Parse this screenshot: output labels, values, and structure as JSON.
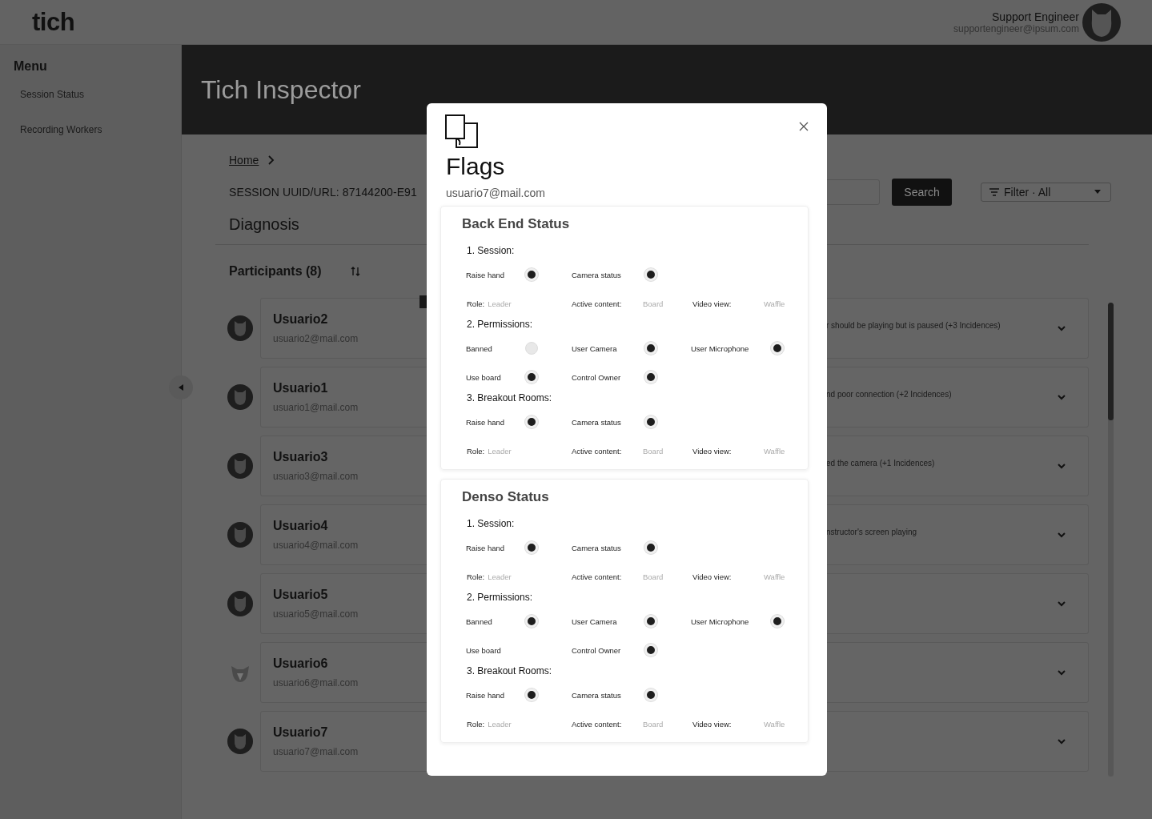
{
  "header": {
    "logo": "tich",
    "user": {
      "name": "Support Engineer",
      "email": "supportengineer@ipsum.com"
    }
  },
  "sidebar": {
    "title": "Menu",
    "items": [
      {
        "label": "Session Status"
      },
      {
        "label": "Recording Workers"
      }
    ]
  },
  "banner": {
    "title": "Tich Inspector"
  },
  "breadcrumb": [
    {
      "label": "Home"
    }
  ],
  "session": {
    "label": "SESSION UUID/URL: 87144200-E91"
  },
  "search": {
    "button": "Search"
  },
  "filter": {
    "label": "Filter · All"
  },
  "diagnosis": {
    "title": "Diagnosis"
  },
  "participants": {
    "title": "Participants (8)",
    "items": [
      {
        "name": "Usuario2",
        "email": "usuario2@mail.com",
        "issue": "r should be playing but is paused (+3 Incidences)",
        "kind": "icon"
      },
      {
        "name": "Usuario1",
        "email": "usuario1@mail.com",
        "issue": "nd poor connection (+2 Incidences)",
        "kind": "icon"
      },
      {
        "name": "Usuario3",
        "email": "usuario3@mail.com",
        "issue": "ed the camera  (+1 Incidences)",
        "kind": "icon"
      },
      {
        "name": "Usuario4",
        "email": "usuario4@mail.com",
        "issue": "nstructor's screen playing",
        "kind": "icon"
      },
      {
        "name": "Usuario5",
        "email": "usuario5@mail.com",
        "kind": "icon"
      },
      {
        "name": "Usuario6",
        "email": "usuario6@mail.com",
        "kind": "light"
      },
      {
        "name": "Usuario7",
        "email": "usuario7@mail.com",
        "kind": "icon"
      }
    ]
  },
  "modal": {
    "title": "Flags",
    "subtitle": "usuario7@mail.com",
    "sections": [
      {
        "title": "Back End Status",
        "groups": [
          {
            "title": "1. Session:",
            "rows": [
              {
                "kind": "flags",
                "items": [
                  {
                    "kind": "flag",
                    "label": "Raise hand",
                    "on": true
                  },
                  {
                    "kind": "flag",
                    "label": "Camera status",
                    "on": true
                  }
                ]
              },
              {
                "kind": "info",
                "items": [
                  {
                    "label": "Role:",
                    "value": "Leader"
                  },
                  {
                    "label": "Active content:",
                    "value": "Board"
                  },
                  {
                    "label": "Video view:",
                    "value": "Waffle"
                  }
                ]
              }
            ]
          },
          {
            "title": "2. Permissions:",
            "rows": [
              {
                "kind": "flags",
                "items": [
                  {
                    "kind": "flag",
                    "label": "Banned",
                    "on": false
                  },
                  {
                    "kind": "flag",
                    "label": "User Camera",
                    "on": true
                  },
                  {
                    "kind": "flag",
                    "label": "User Microphone",
                    "on": true
                  }
                ]
              },
              {
                "kind": "flags",
                "items": [
                  {
                    "kind": "flag",
                    "label": "Use board",
                    "on": true
                  },
                  {
                    "kind": "flag",
                    "label": "Control Owner",
                    "on": true
                  }
                ]
              }
            ]
          },
          {
            "title": "3. Breakout Rooms:",
            "rows": [
              {
                "kind": "flags",
                "items": [
                  {
                    "kind": "flag",
                    "label": "Raise hand",
                    "on": true
                  },
                  {
                    "kind": "flag",
                    "label": "Camera status",
                    "on": true
                  }
                ]
              },
              {
                "kind": "info",
                "items": [
                  {
                    "label": "Role:",
                    "value": "Leader"
                  },
                  {
                    "label": "Active content:",
                    "value": "Board"
                  },
                  {
                    "label": "Video view:",
                    "value": "Waffle"
                  }
                ]
              }
            ]
          }
        ]
      },
      {
        "title": "Denso Status",
        "groups": [
          {
            "title": "1. Session:",
            "rows": [
              {
                "kind": "flags",
                "items": [
                  {
                    "kind": "flag",
                    "label": "Raise hand",
                    "on": true
                  },
                  {
                    "kind": "flag",
                    "label": "Camera status",
                    "on": true
                  }
                ]
              },
              {
                "kind": "info",
                "items": [
                  {
                    "label": "Role:",
                    "value": "Leader"
                  },
                  {
                    "label": "Active content:",
                    "value": "Board"
                  },
                  {
                    "label": "Video view:",
                    "value": "Waffle"
                  }
                ]
              }
            ]
          },
          {
            "title": "2. Permissions:",
            "rows": [
              {
                "kind": "flags",
                "items": [
                  {
                    "kind": "flag",
                    "label": "Banned",
                    "on": true
                  },
                  {
                    "kind": "flag",
                    "label": "User Camera",
                    "on": true
                  },
                  {
                    "kind": "flag",
                    "label": "User Microphone",
                    "on": true
                  }
                ]
              },
              {
                "kind": "flags",
                "items": [
                  {
                    "kind": "label",
                    "label": "Use board"
                  },
                  {
                    "kind": "flag",
                    "label": "Control Owner",
                    "on": true
                  }
                ]
              }
            ]
          },
          {
            "title": "3. Breakout Rooms:",
            "rows": [
              {
                "kind": "flags",
                "items": [
                  {
                    "kind": "flag",
                    "label": "Raise hand",
                    "on": true
                  },
                  {
                    "kind": "flag",
                    "label": "Camera status",
                    "on": true
                  }
                ]
              },
              {
                "kind": "info",
                "items": [
                  {
                    "label": "Role:",
                    "value": "Leader"
                  },
                  {
                    "label": "Active content:",
                    "value": "Board"
                  },
                  {
                    "label": "Video view:",
                    "value": "Waffle"
                  }
                ]
              }
            ]
          }
        ]
      }
    ]
  }
}
